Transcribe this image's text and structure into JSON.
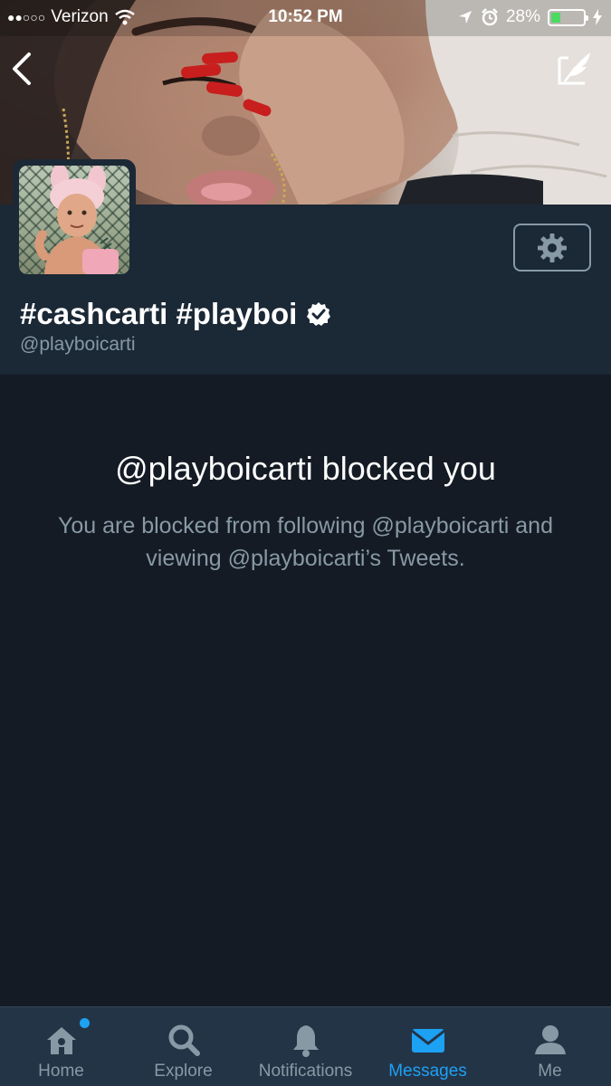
{
  "status_bar": {
    "signal_dots": "●●○○○",
    "carrier": "Verizon",
    "time": "10:52 PM",
    "battery_percent": "28%",
    "battery_level": 0.28,
    "icons": [
      "wifi-icon",
      "location-icon",
      "alarm-icon",
      "battery-icon",
      "charging-icon"
    ]
  },
  "nav": {
    "back_icon": "chevron-left-icon",
    "compose_icon": "compose-tweet-icon"
  },
  "profile": {
    "display_name": "#cashcarti #playboi",
    "handle": "@playboicarti",
    "verified": true,
    "settings_icon": "gear-icon"
  },
  "blocked": {
    "title": "@playboicarti blocked you",
    "description": "You are blocked from following @playboicarti and viewing @playboicarti’s Tweets."
  },
  "tabs": [
    {
      "label": "Home",
      "icon": "home-icon",
      "has_notification_dot": true,
      "active": false
    },
    {
      "label": "Explore",
      "icon": "search-icon",
      "active": false
    },
    {
      "label": "Notifications",
      "icon": "bell-icon",
      "active": false
    },
    {
      "label": "Messages",
      "icon": "envelope-icon",
      "active": true
    },
    {
      "label": "Me",
      "icon": "person-icon",
      "active": false
    }
  ],
  "colors": {
    "background": "#141b24",
    "profile_background": "#1b2836",
    "tab_bar": "#243447",
    "accent": "#1da1f2",
    "muted_text": "#8899a6"
  }
}
